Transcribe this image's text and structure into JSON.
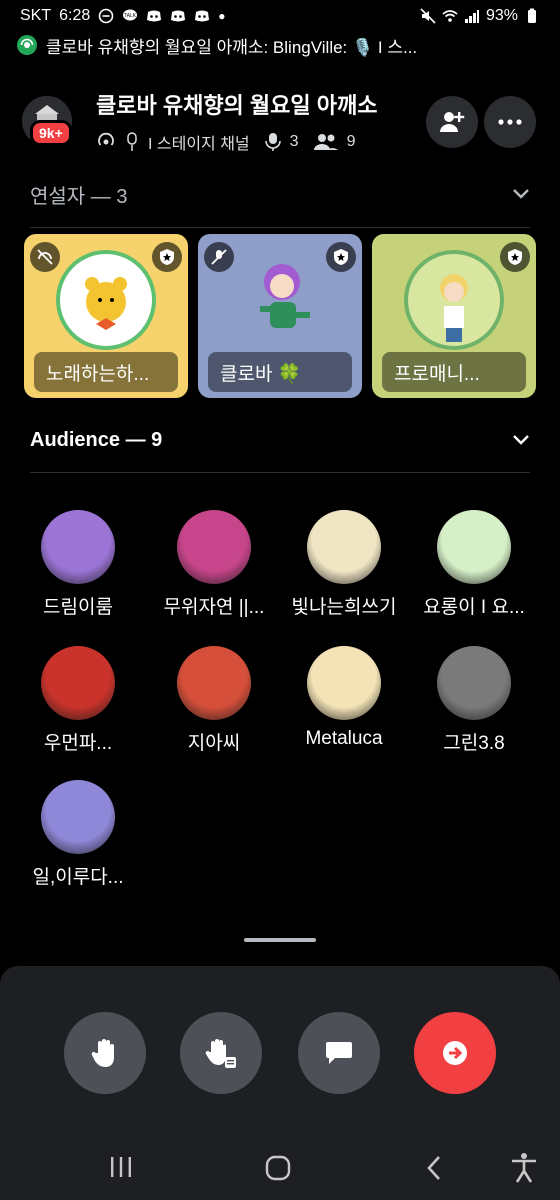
{
  "status_bar": {
    "carrier": "SKT",
    "time": "6:28",
    "battery": "93%"
  },
  "notification": {
    "text": "클로바 유채향의 월요일 아깨소: BlingVille: 🎙️ I 스..."
  },
  "header": {
    "title": "클로바 유채향의 월요일 아깨소",
    "server_badge": "9k+",
    "channel_type": "I 스테이지 채널",
    "speaker_count": "3",
    "listener_count": "9"
  },
  "speakers_section": {
    "label": "연설자 — 3"
  },
  "speakers": [
    {
      "name": "노래하는하...",
      "bg": "#f5d26b",
      "pill_bg": "rgba(0,0,0,0.35)"
    },
    {
      "name": "클로바 🍀",
      "bg": "#8e9ec8",
      "pill_bg": "rgba(0,0,0,0.35)"
    },
    {
      "name": "프로매니...",
      "bg": "#c6d27a",
      "pill_bg": "rgba(0,0,0,0.35)"
    }
  ],
  "audience_section": {
    "label": "Audience — 9"
  },
  "audience": [
    {
      "name": "드림이룸",
      "color": "#9b74d6"
    },
    {
      "name": "무위자연 ||...",
      "color": "#c7458a"
    },
    {
      "name": "빛나는희쓰기",
      "color": "#f1e6c4"
    },
    {
      "name": "요롱이 I 요...",
      "color": "#d5efc7"
    },
    {
      "name": "우먼파...",
      "color": "#c9332b"
    },
    {
      "name": "지아씨",
      "color": "#d64f3a"
    },
    {
      "name": "Metaluca",
      "color": "#f3e3b6"
    },
    {
      "name": "그린3.8",
      "color": "#7a7a7a"
    },
    {
      "name": "일,이루다...",
      "color": "#8f88d9"
    }
  ],
  "colors": {
    "leave": "#f23f42",
    "control": "#4e5058",
    "panel": "#1e1f22"
  }
}
